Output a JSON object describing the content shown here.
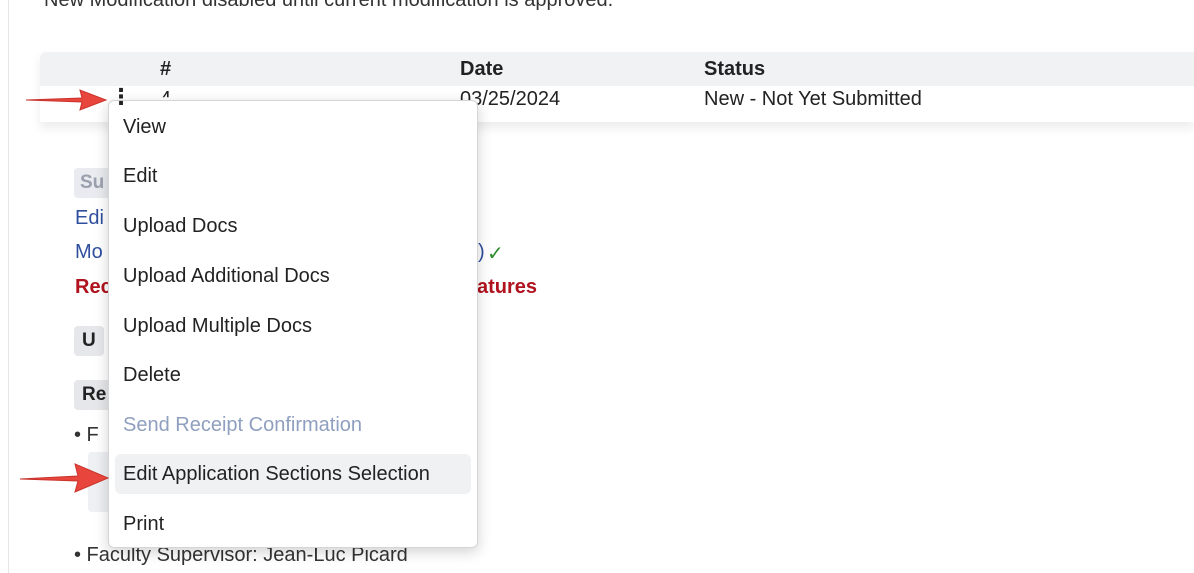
{
  "notice": "New Modification disabled until current modification is approved.",
  "table": {
    "headers": {
      "number": "#",
      "date": "Date",
      "status": "Status"
    },
    "row": {
      "number": "4",
      "date": "03/25/2024",
      "status": "New - Not Yet Submitted"
    }
  },
  "background": {
    "chip1": "Su",
    "link1": "Edi",
    "link2": "Mo",
    "link2_suffix": ")",
    "check": "✓",
    "red_prefix": "Rec",
    "red_suffix": "atures",
    "chip_up": "U",
    "chip_re": "Re",
    "bullet1": "• F",
    "bullet2": "• Faculty Supervisor: Jean-Luc Picard"
  },
  "menu": {
    "items": [
      {
        "label": "View",
        "disabled": false
      },
      {
        "label": "Edit",
        "disabled": false
      },
      {
        "label": "Upload Docs",
        "disabled": false
      },
      {
        "label": "Upload Additional Docs",
        "disabled": false
      },
      {
        "label": "Upload Multiple Docs",
        "disabled": false
      },
      {
        "label": "Delete",
        "disabled": false
      },
      {
        "label": "Send Receipt Confirmation",
        "disabled": true
      },
      {
        "label": "Edit Application Sections Selection",
        "disabled": false,
        "hovered": true
      },
      {
        "label": "Print",
        "disabled": false
      }
    ]
  },
  "icons": {
    "row_menu": "kebab-menu-icon",
    "pointer": "red-arrow-icon"
  },
  "colors": {
    "arrow": "#e8453c",
    "link": "#2f4f9e",
    "danger": "#b0131e",
    "disabled": "#8f9fbf"
  }
}
